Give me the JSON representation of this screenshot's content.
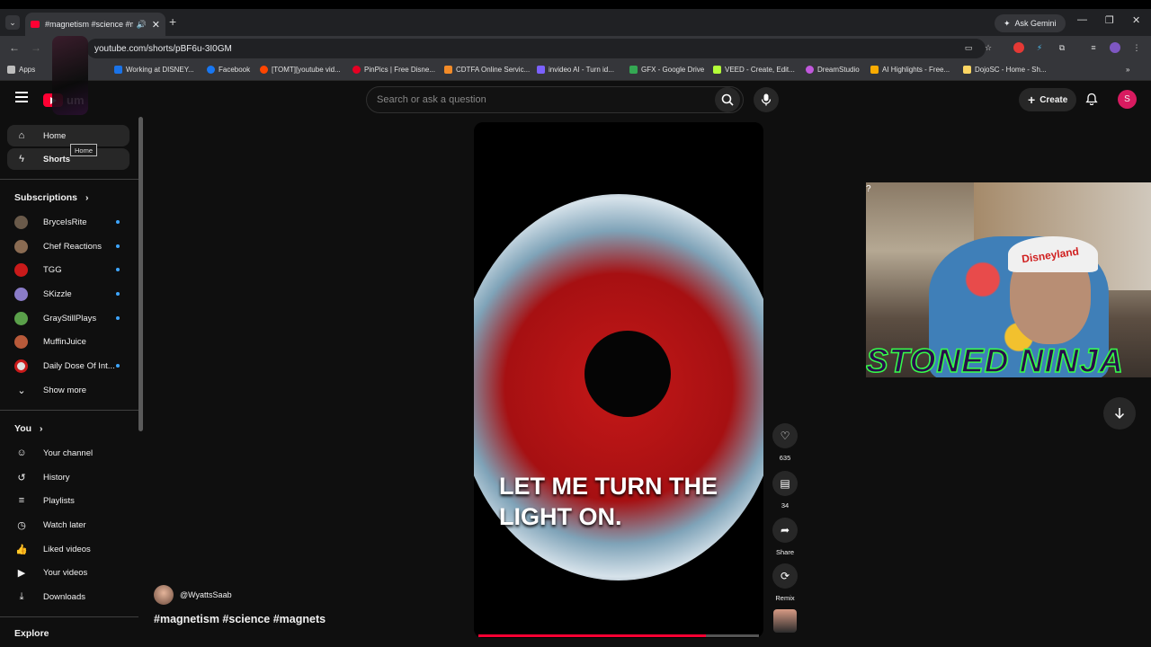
{
  "browser": {
    "tab_title": "#magnetism #science #mag",
    "url": "youtube.com/shorts/pBF6u-3I0GM",
    "ask_gemini": "Ask Gemini",
    "bookmarks": [
      {
        "label": "Apps",
        "color": "#e8eaed"
      },
      {
        "label": "Working at DISNEY...",
        "color": "#1a73e8"
      },
      {
        "label": "Facebook",
        "color": "#1877f2"
      },
      {
        "label": "[TOMT][youtube vid...",
        "color": "#ff4500"
      },
      {
        "label": "PinPics | Free Disne...",
        "color": "#e60023"
      },
      {
        "label": "CDTFA Online Servic...",
        "color": "#f28b28"
      },
      {
        "label": "invideo AI - Turn id...",
        "color": "#7b61ff"
      },
      {
        "label": "GFX - Google Drive",
        "color": "#34a853"
      },
      {
        "label": "VEED - Create, Edit...",
        "color": "#b4ff39"
      },
      {
        "label": "DreamStudio",
        "color": "#c158dc"
      },
      {
        "label": "AI Highlights - Free...",
        "color": "#f9ab00"
      },
      {
        "label": "DojoSC - Home - Sh...",
        "color": "#fdd663"
      }
    ]
  },
  "header": {
    "logo_text": "um",
    "search_placeholder": "Search or ask a question",
    "create_label": "Create",
    "avatar_letter": "S"
  },
  "sidebar": {
    "home": "Home",
    "shorts": "Shorts",
    "tooltip": "Home",
    "subscriptions_title": "Subscriptions",
    "subscriptions": [
      {
        "name": "BryceIsRite",
        "color": "#6a5a4a"
      },
      {
        "name": "Chef Reactions",
        "color": "#8a6b52"
      },
      {
        "name": "TGG",
        "color": "#c91a1a"
      },
      {
        "name": "SKizzle",
        "color": "#8a7cc8"
      },
      {
        "name": "GrayStillPlays",
        "color": "#5aa04a"
      },
      {
        "name": "MuffinJuice",
        "color": "#b85a3a"
      },
      {
        "name": "Daily Dose Of Int...",
        "color": "#e0e0e0"
      }
    ],
    "show_more": "Show more",
    "you_title": "You",
    "you_items": [
      "Your channel",
      "History",
      "Playlists",
      "Watch later",
      "Liked videos",
      "Your videos",
      "Downloads"
    ],
    "explore_title": "Explore"
  },
  "video": {
    "caption_line1": "LET ME TURN THE",
    "caption_line2": "LIGHT ON.",
    "progress": 0.81,
    "like_count": "635",
    "comment_count": "34",
    "share_label": "Share",
    "remix_label": "Remix",
    "channel": "@WyattsSaab",
    "title": "#magnetism #science #magnets"
  },
  "overlay": {
    "streamer_text": "STONED NINJA",
    "hat_text": "Disneyland",
    "corner_mark": "?"
  }
}
